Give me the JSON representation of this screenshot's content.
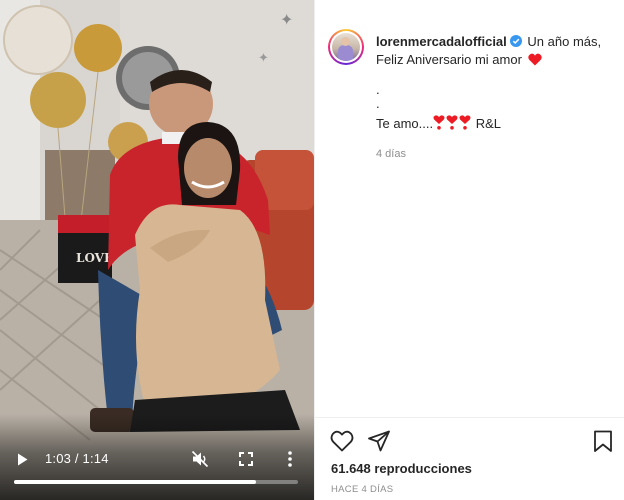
{
  "post": {
    "username": "lorenmercadalofficial",
    "caption_line1": "Un año más,",
    "caption_line2": "Feliz Aniversario mi amor",
    "caption_dot1": ".",
    "caption_dot2": ".",
    "caption_line3": "Te amo....",
    "caption_signature": "R&L",
    "posted_relative": "4 días",
    "views_label": "61.648 reproducciones",
    "posted_ago": "HACE 4 DÍAS"
  },
  "player": {
    "time_label": "1:03 / 1:14",
    "progress": 0.851,
    "sign_text": "LOVE"
  },
  "icons": {
    "play": "play-icon",
    "mute": "mute-icon",
    "fullscreen": "fullscreen-icon",
    "more": "more-options-icon",
    "verified": "verified-badge-icon",
    "heart": "heart-icon",
    "like": "like-icon",
    "share": "share-icon",
    "save": "bookmark-icon"
  },
  "colors": {
    "verified_blue": "#3897f0",
    "heart_red": "#ed1c24",
    "muted_text": "#8e8e8e",
    "text": "#262626"
  }
}
